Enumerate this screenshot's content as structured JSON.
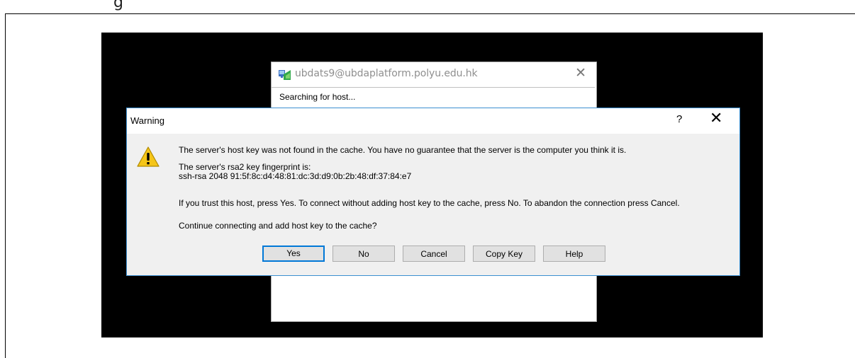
{
  "document": {
    "snippet_text": "g"
  },
  "bg_window": {
    "title": "ubdats9@ubdaplatform.polyu.edu.hk",
    "close_glyph": "✕",
    "status_text": "Searching for host..."
  },
  "dialog": {
    "title": "Warning",
    "help_glyph": "?",
    "close_glyph": "✕",
    "icon": "warning-icon",
    "message_line1": "The server's host key was not found in the cache. You have no guarantee that the server is the computer you think it is.",
    "fingerprint_label": "The server's rsa2 key fingerprint is:",
    "fingerprint_value": "ssh-rsa 2048 91:5f:8c:d4:48:81:dc:3d:d9:0b:2b:48:df:37:84:e7",
    "trust_text": "If you trust this host, press Yes. To connect without adding host key to the cache, press No. To abandon the connection press Cancel.",
    "question": "Continue connecting and add host key to the cache?",
    "buttons": {
      "yes": "Yes",
      "no": "No",
      "cancel": "Cancel",
      "copy_key": "Copy Key",
      "help": "Help"
    }
  },
  "colors": {
    "dialog_border": "#3b8fd0",
    "default_button_border": "#0078d7",
    "warning_yellow": "#f5c518"
  }
}
